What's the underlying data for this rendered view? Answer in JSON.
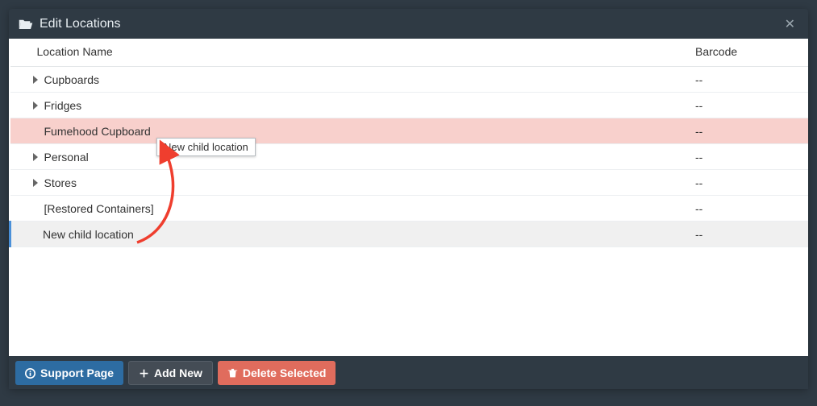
{
  "dialog": {
    "title": "Edit Locations"
  },
  "columns": {
    "name": "Location Name",
    "barcode": "Barcode"
  },
  "rows": [
    {
      "name": "Cupboards",
      "barcode": "--",
      "expandable": true,
      "selected": false,
      "editing": false
    },
    {
      "name": "Fridges",
      "barcode": "--",
      "expandable": true,
      "selected": false,
      "editing": false
    },
    {
      "name": "Fumehood Cupboard",
      "barcode": "--",
      "expandable": false,
      "selected": true,
      "editing": false
    },
    {
      "name": "Personal",
      "barcode": "--",
      "expandable": true,
      "selected": false,
      "editing": false
    },
    {
      "name": "Stores",
      "barcode": "--",
      "expandable": true,
      "selected": false,
      "editing": false
    },
    {
      "name": "[Restored Containers]",
      "barcode": "--",
      "expandable": false,
      "selected": false,
      "editing": false
    },
    {
      "name": "New child location",
      "barcode": "--",
      "expandable": false,
      "selected": false,
      "editing": true
    }
  ],
  "tooltip": "New child location",
  "footer": {
    "support": "Support Page",
    "add": "Add New",
    "delete": "Delete Selected"
  }
}
